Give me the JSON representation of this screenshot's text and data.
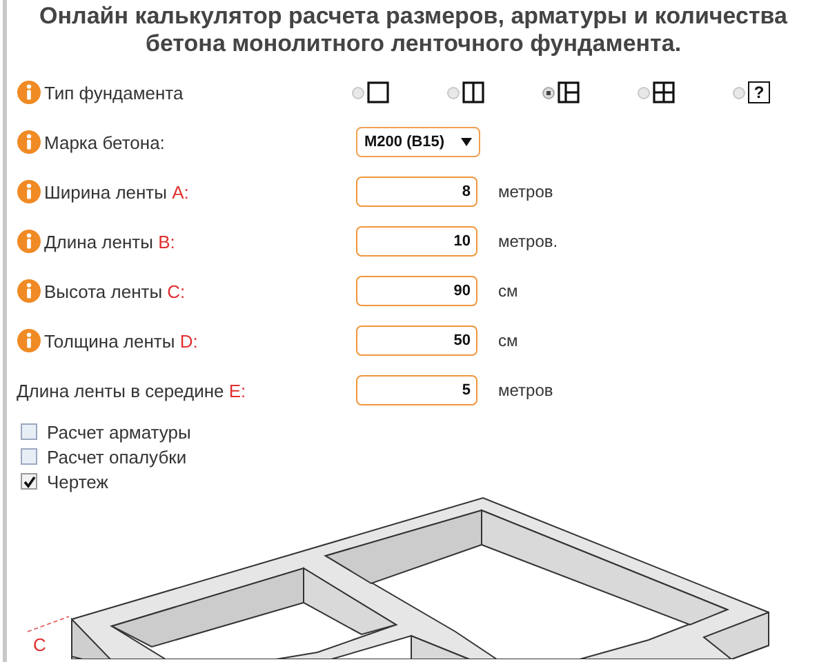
{
  "title": "Онлайн калькулятор расчета размеров, арматуры и количества бетона монолитного ленточного фундамента.",
  "foundation_type": {
    "label": "Тип фундамента",
    "info": true,
    "options": [
      {
        "kind": "square",
        "selected": false
      },
      {
        "kind": "two-rooms",
        "selected": false
      },
      {
        "kind": "three-rooms",
        "selected": true
      },
      {
        "kind": "four-rooms",
        "selected": false
      },
      {
        "kind": "custom",
        "glyph": "?",
        "selected": false
      }
    ]
  },
  "concrete_grade": {
    "label": "Марка бетона:",
    "info": true,
    "value": "M200 (B15)"
  },
  "fields": [
    {
      "label": "Ширина ленты",
      "letter": "A:",
      "info": true,
      "value": "8",
      "unit": "метров"
    },
    {
      "label": "Длина ленты",
      "letter": "B:",
      "info": true,
      "value": "10",
      "unit": "метров."
    },
    {
      "label": "Высота ленты",
      "letter": "C:",
      "info": true,
      "value": "90",
      "unit": "см"
    },
    {
      "label": "Толщина ленты",
      "letter": "D:",
      "info": true,
      "value": "50",
      "unit": "см"
    },
    {
      "label": "Длина ленты в середине",
      "letter": "E:",
      "info": false,
      "value": "5",
      "unit": "метров"
    }
  ],
  "options": [
    {
      "label": "Расчет арматуры",
      "checked": false
    },
    {
      "label": "Расчет опалубки",
      "checked": false
    },
    {
      "label": "Чертеж",
      "checked": true
    }
  ],
  "drawing": {
    "dimension_label": "C"
  }
}
